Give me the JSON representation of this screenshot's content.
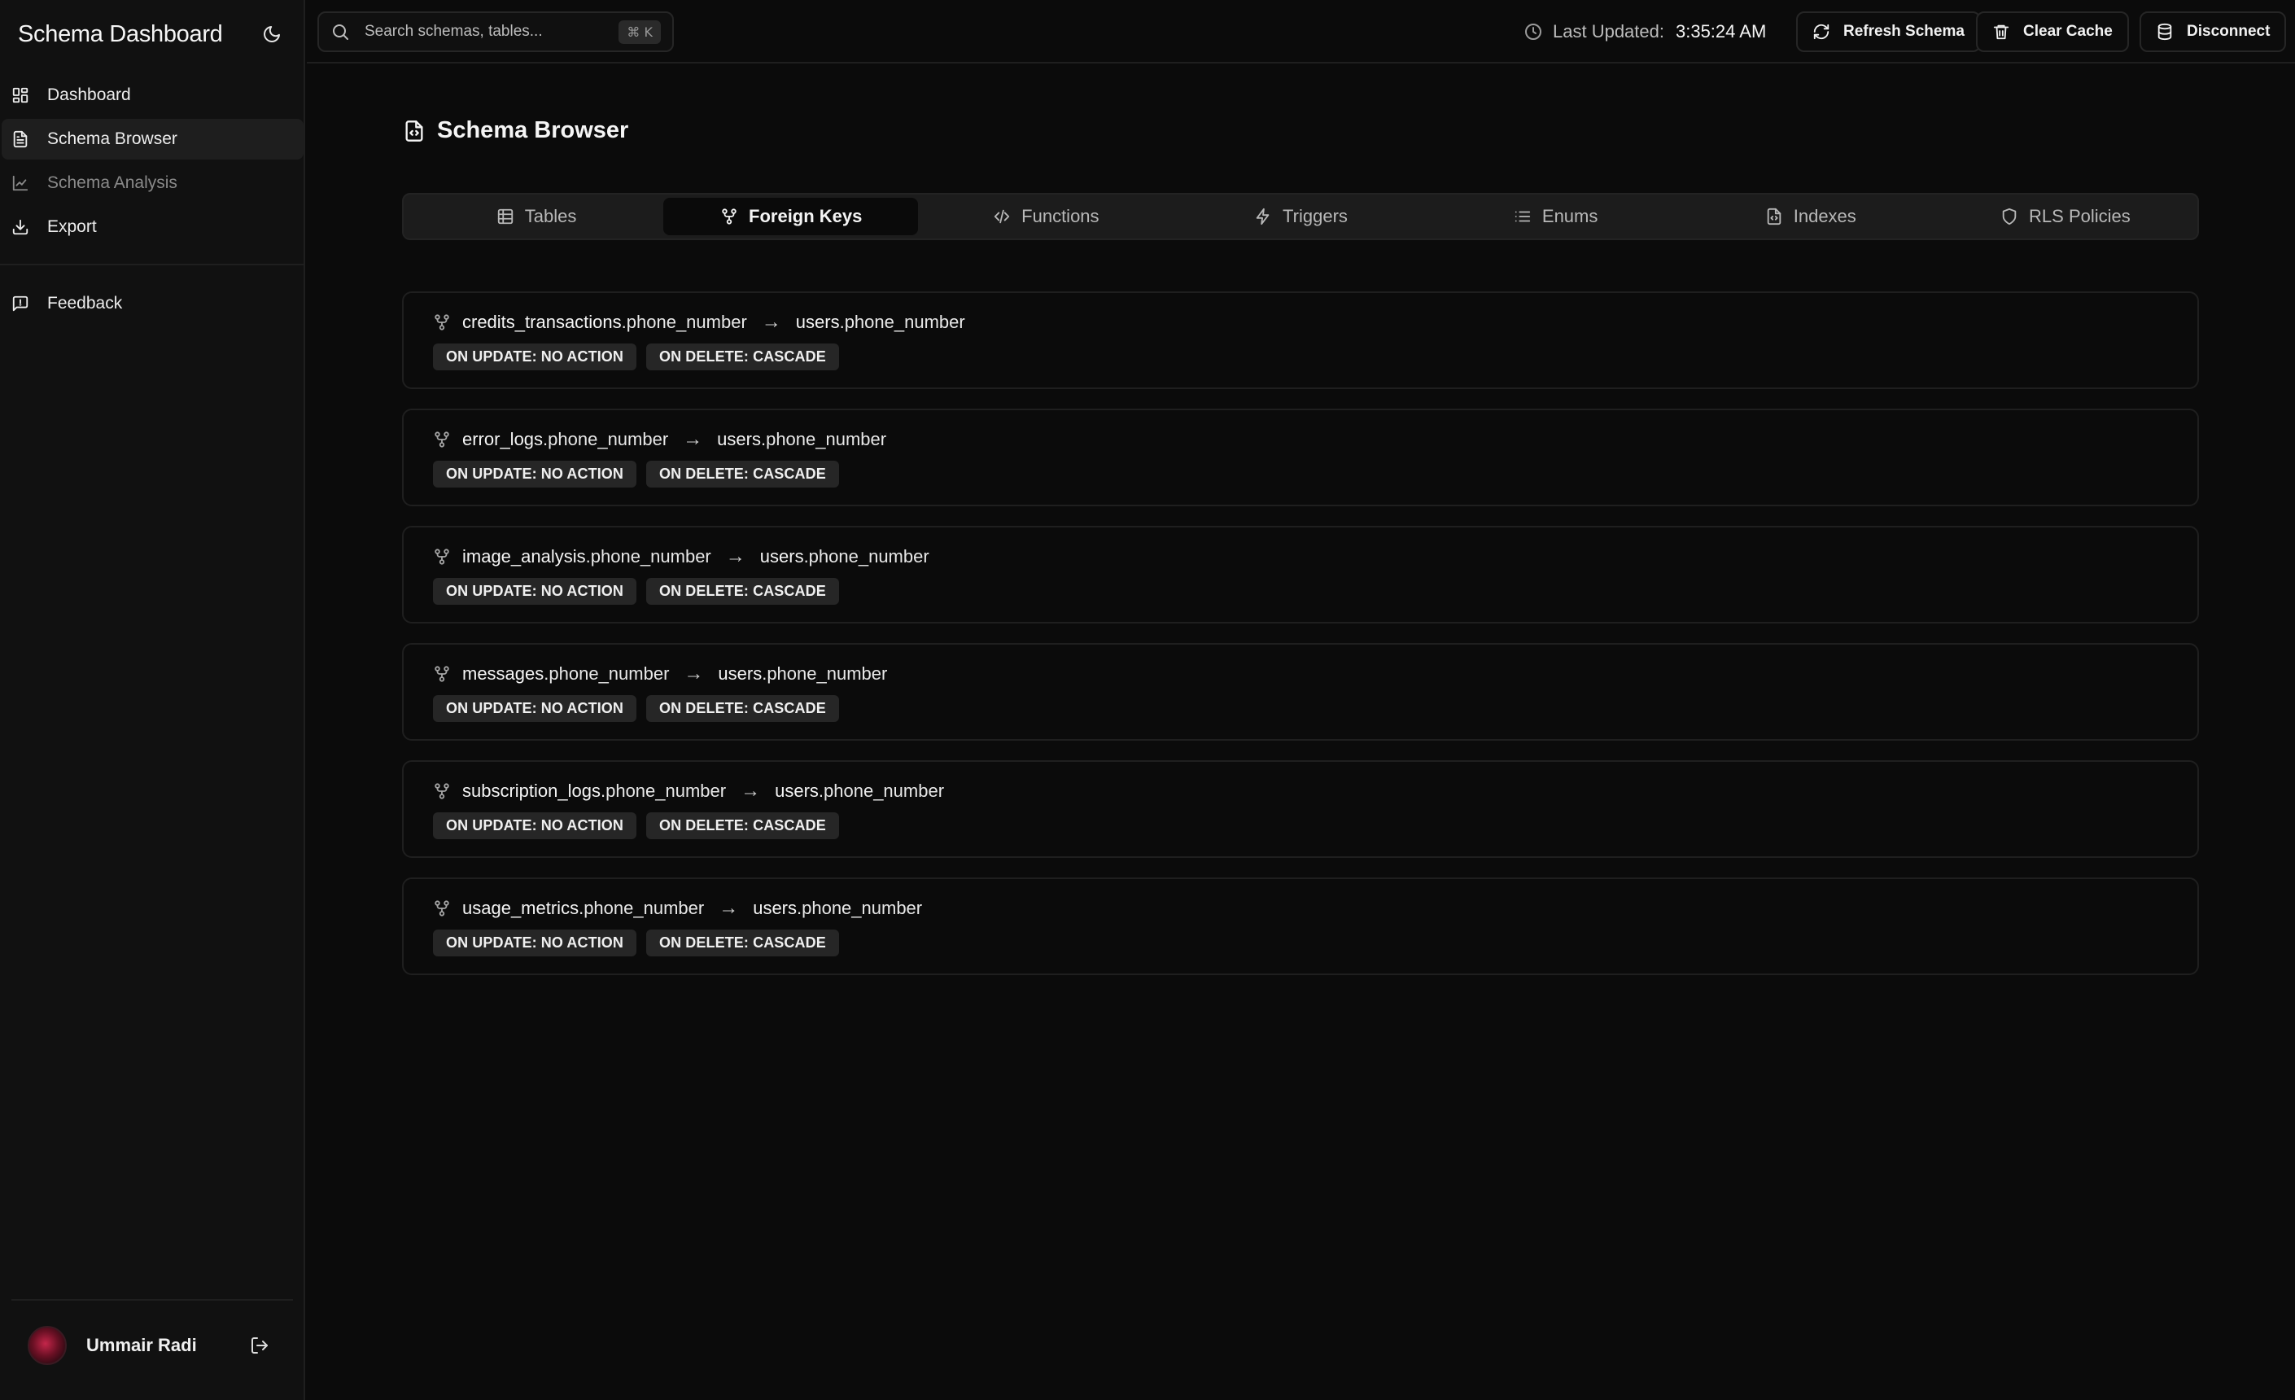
{
  "app": {
    "title": "Schema Dashboard"
  },
  "sidebar": {
    "items": [
      {
        "label": "Dashboard",
        "icon": "dashboard-grid-icon",
        "state": "normal"
      },
      {
        "label": "Schema Browser",
        "icon": "document-icon",
        "state": "active"
      },
      {
        "label": "Schema Analysis",
        "icon": "line-chart-icon",
        "state": "disabled"
      },
      {
        "label": "Export",
        "icon": "download-icon",
        "state": "normal"
      }
    ],
    "feedback_label": "Feedback",
    "user": {
      "name": "Ummair Radi"
    }
  },
  "topbar": {
    "search_placeholder": "Search schemas, tables...",
    "search_shortcut": "⌘ K",
    "last_updated_label": "Last Updated:",
    "last_updated_time": "3:35:24 AM",
    "refresh_label": "Refresh Schema",
    "clear_cache_label": "Clear Cache",
    "disconnect_label": "Disconnect"
  },
  "main": {
    "page_title": "Schema Browser",
    "tabs": [
      {
        "label": "Tables",
        "icon": "table-icon"
      },
      {
        "label": "Foreign Keys",
        "icon": "git-fork-icon",
        "active": true
      },
      {
        "label": "Functions",
        "icon": "code-icon"
      },
      {
        "label": "Triggers",
        "icon": "lightning-icon"
      },
      {
        "label": "Enums",
        "icon": "list-icon"
      },
      {
        "label": "Indexes",
        "icon": "file-code-icon"
      },
      {
        "label": "RLS Policies",
        "icon": "shield-icon"
      }
    ],
    "foreign_keys": [
      {
        "source_table": "credits_transactions",
        "source_column": ".phone_number",
        "target_table": "users",
        "target_column": ".phone_number",
        "on_update": "ON UPDATE: NO ACTION",
        "on_delete": "ON DELETE: CASCADE"
      },
      {
        "source_table": "error_logs",
        "source_column": ".phone_number",
        "target_table": "users",
        "target_column": ".phone_number",
        "on_update": "ON UPDATE: NO ACTION",
        "on_delete": "ON DELETE: CASCADE"
      },
      {
        "source_table": "image_analysis",
        "source_column": ".phone_number",
        "target_table": "users",
        "target_column": ".phone_number",
        "on_update": "ON UPDATE: NO ACTION",
        "on_delete": "ON DELETE: CASCADE"
      },
      {
        "source_table": "messages",
        "source_column": ".phone_number",
        "target_table": "users",
        "target_column": ".phone_number",
        "on_update": "ON UPDATE: NO ACTION",
        "on_delete": "ON DELETE: CASCADE"
      },
      {
        "source_table": "subscription_logs",
        "source_column": ".phone_number",
        "target_table": "users",
        "target_column": ".phone_number",
        "on_update": "ON UPDATE: NO ACTION",
        "on_delete": "ON DELETE: CASCADE"
      },
      {
        "source_table": "usage_metrics",
        "source_column": ".phone_number",
        "target_table": "users",
        "target_column": ".phone_number",
        "on_update": "ON UPDATE: NO ACTION",
        "on_delete": "ON DELETE: CASCADE"
      }
    ],
    "arrow_glyph": "→"
  }
}
